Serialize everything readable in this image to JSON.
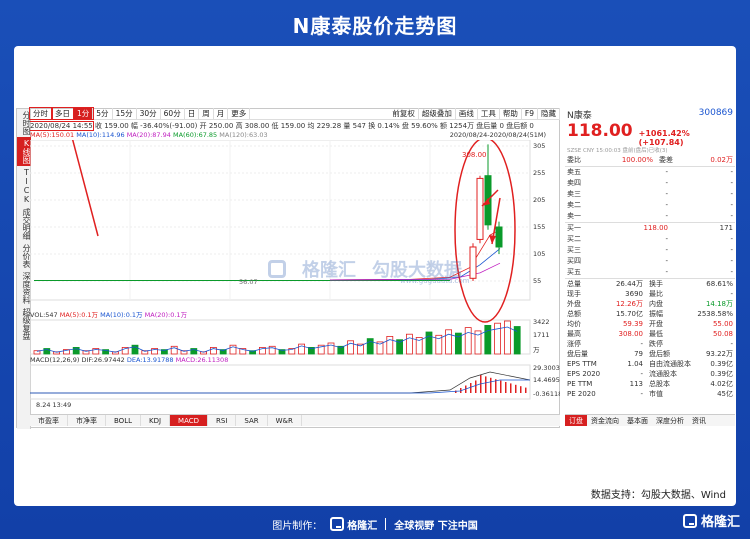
{
  "page_title": "N康泰股价走势图",
  "left_nav": [
    {
      "label": "分时图",
      "active": false
    },
    {
      "label": "K线图",
      "active": true
    },
    {
      "label": "TICK",
      "active": false
    },
    {
      "label": "成交明细",
      "active": false
    },
    {
      "label": "分价表",
      "active": false
    },
    {
      "label": "深度资料",
      "active": false
    },
    {
      "label": "超级复盘",
      "active": false
    }
  ],
  "period_tabs": [
    "分时",
    "多日",
    "1分",
    "5分",
    "15分",
    "30分",
    "60分",
    "日",
    "周",
    "月",
    "更多"
  ],
  "right_tabs": [
    "前复权",
    "超级叠加",
    "画线",
    "工具",
    "帮助",
    "F9",
    "隐藏"
  ],
  "info_line": {
    "date": "2020/08/24 14:55",
    "rest": "收 159.00  幅 -36.40%(-91.00)  开 250.00  高 308.00  低 159.00  均 229.28  量 547  换 0.14%  盘 59.60%  额 1254万  盘后量 0  盘后额 0"
  },
  "ma_line": {
    "ma5": "MA(5):150.01",
    "ma10": "MA(10):114.96",
    "ma20": "MA(20):87.94",
    "ma60": "MA(60):67.85",
    "ma120": "MA(120):63.03",
    "range": "2020/08/24-2020/08/24(51M)"
  },
  "price_axis": [
    "305",
    "255",
    "205",
    "155",
    "105",
    "55"
  ],
  "price_high_label": "308.00",
  "price_low_label": "56.07",
  "vol_header": {
    "vol": "VOL:547",
    "ma5": "MA(5):0.1万",
    "ma10": "MA(10):0.1万",
    "ma20": "MA(20):0.1万"
  },
  "vol_axis": [
    "3422",
    "1711",
    "万"
  ],
  "macd_header": {
    "title": "MACD(12,26,9)",
    "dif": "DIF:26.97442",
    "dea": "DEA:13.91788",
    "macd": "MACD:26.11308"
  },
  "macd_axis": [
    "29.30030",
    "14.46956",
    "-0.36118"
  ],
  "time_label": "8.24 13:49",
  "bottom_tabs": [
    "市盈率",
    "市净率",
    "BOLL",
    "KDJ",
    "MACD",
    "RSI",
    "SAR",
    "W&R"
  ],
  "watermark": {
    "a": "格隆汇",
    "b": "勾股大数据",
    "c": "www.gugudata.com"
  },
  "quote": {
    "name": "N康泰",
    "code": "300869",
    "price": "118.00",
    "change": "+1061.42%(+107.84)",
    "sub": "SZSE  CNY  15:00:03   盘前(盘后)已收(3)",
    "webi_label": "委比",
    "webi_val": "100.00%",
    "wecha_label": "委差",
    "wecha_val": "0.02万",
    "asks": [
      {
        "label": "卖五",
        "price": "-",
        "vol": "-"
      },
      {
        "label": "卖四",
        "price": "-",
        "vol": "-"
      },
      {
        "label": "卖三",
        "price": "-",
        "vol": "-"
      },
      {
        "label": "卖二",
        "price": "-",
        "vol": "-"
      },
      {
        "label": "卖一",
        "price": "-",
        "vol": "-"
      }
    ],
    "bids": [
      {
        "label": "买一",
        "price": "118.00",
        "vol": "171"
      },
      {
        "label": "买二",
        "price": "-",
        "vol": "-"
      },
      {
        "label": "买三",
        "price": "-",
        "vol": "-"
      },
      {
        "label": "买四",
        "price": "-",
        "vol": "-"
      },
      {
        "label": "买五",
        "price": "-",
        "vol": "-"
      }
    ],
    "stats": [
      {
        "l1": "总量",
        "v1": "26.44万",
        "l2": "换手",
        "v2": "68.61%",
        "c1": "",
        "c2": ""
      },
      {
        "l1": "现手",
        "v1": "3690",
        "l2": "最比",
        "v2": "-",
        "c1": "",
        "c2": ""
      },
      {
        "l1": "外盘",
        "v1": "12.26万",
        "l2": "内盘",
        "v2": "14.18万",
        "c1": "red",
        "c2": "green"
      },
      {
        "l1": "总额",
        "v1": "15.70亿",
        "l2": "振幅",
        "v2": "2538.58%",
        "c1": "",
        "c2": ""
      },
      {
        "l1": "均价",
        "v1": "59.39",
        "l2": "开盘",
        "v2": "55.00",
        "c1": "red",
        "c2": "red"
      },
      {
        "l1": "最高",
        "v1": "308.00",
        "l2": "最低",
        "v2": "50.08",
        "c1": "red",
        "c2": "red"
      },
      {
        "l1": "涨停",
        "v1": "-",
        "l2": "跌停",
        "v2": "-",
        "c1": "",
        "c2": ""
      },
      {
        "l1": "盘后量",
        "v1": "79",
        "l2": "盘后额",
        "v2": "93.22万",
        "c1": "",
        "c2": ""
      },
      {
        "l1": "EPS TTM",
        "v1": "1.04",
        "l2": "自由流通股本",
        "v2": "0.39亿",
        "c1": "",
        "c2": ""
      },
      {
        "l1": "EPS 2020",
        "v1": "-",
        "l2": "流通股本",
        "v2": "0.39亿",
        "c1": "",
        "c2": ""
      },
      {
        "l1": "PE TTM",
        "v1": "113",
        "l2": "总股本",
        "v2": "4.02亿",
        "c1": "",
        "c2": ""
      },
      {
        "l1": "PE 2020",
        "v1": "-",
        "l2": "市值",
        "v2": "45亿",
        "c1": "",
        "c2": ""
      }
    ],
    "tabs": [
      "订盘",
      "资金流向",
      "基本面",
      "深度分析",
      "资讯"
    ]
  },
  "source": "数据支持：勾股大数据、Wind",
  "footer": {
    "made_by": "图片制作：",
    "brand": "格隆汇",
    "slogan": "全球视野 下注中国",
    "right_brand": "格隆汇"
  }
}
